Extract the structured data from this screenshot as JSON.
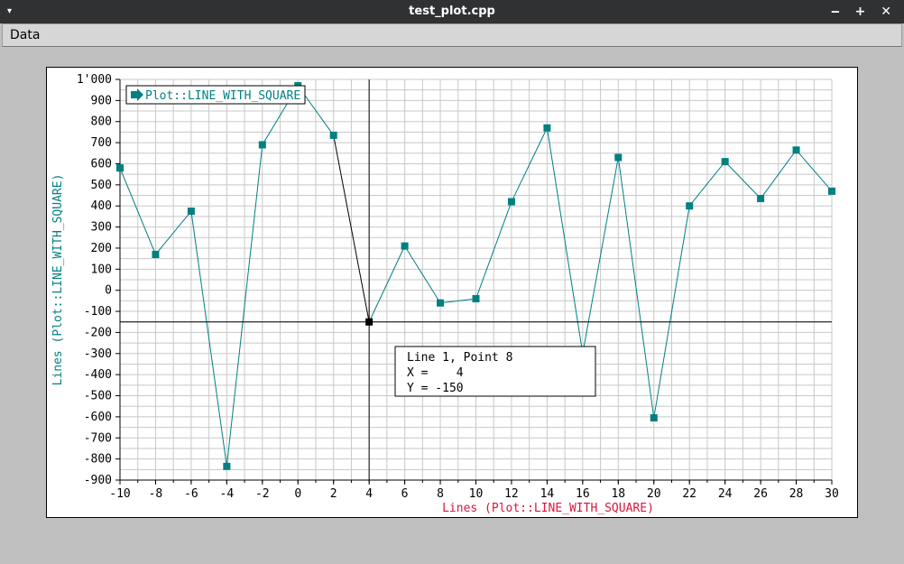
{
  "window": {
    "title": "test_plot.cpp",
    "menu_caret": "▾",
    "controls": "‒ + ✕"
  },
  "menu": {
    "items": [
      "Data"
    ]
  },
  "colors": {
    "series": "#008080",
    "xlabel": "#dc143c",
    "ylabel": "#008080",
    "grid": "#c8c8c8",
    "crosshair": "#000000"
  },
  "chart_data": {
    "type": "line",
    "title": "",
    "xlabel": "Lines (Plot::LINE_WITH_SQUARE)",
    "ylabel": "Lines (Plot::LINE_WITH_SQUARE)",
    "xlim": [
      -10,
      30
    ],
    "ylim": [
      -900,
      1000
    ],
    "grid": true,
    "legend_position": "top-left",
    "x_ticks": [
      -10,
      -8,
      -6,
      -4,
      -2,
      0,
      2,
      4,
      6,
      8,
      10,
      12,
      14,
      16,
      18,
      20,
      22,
      24,
      26,
      28,
      30
    ],
    "x_tick_labels": [
      "-10",
      "-8",
      "-6",
      "-4",
      "-2",
      "0",
      "2",
      "4",
      "6",
      "8",
      "10",
      "12",
      "14",
      "16",
      "18",
      "20",
      "22",
      "24",
      "26",
      "28",
      "30"
    ],
    "y_ticks": [
      -900,
      -800,
      -700,
      -600,
      -500,
      -400,
      -300,
      -200,
      -100,
      0,
      100,
      200,
      300,
      400,
      500,
      600,
      700,
      800,
      900,
      1000
    ],
    "y_tick_labels": [
      "-900",
      "-800",
      "-700",
      "-600",
      "-500",
      "-400",
      "-300",
      "-200",
      "-100",
      "0",
      "100",
      "200",
      "300",
      "400",
      "500",
      "600",
      "700",
      "800",
      "900",
      "1'000"
    ],
    "series": [
      {
        "name": "Plot::LINE_WITH_SQUARE",
        "x": [
          -10,
          -8,
          -6,
          -4,
          -2,
          0,
          2,
          4,
          6,
          8,
          10,
          12,
          14,
          16,
          18,
          20,
          22,
          24,
          26,
          28,
          30
        ],
        "values": [
          580,
          170,
          375,
          -835,
          690,
          970,
          735,
          -150,
          210,
          -60,
          -40,
          420,
          770,
          -300,
          630,
          -605,
          400,
          610,
          435,
          665,
          470
        ]
      }
    ],
    "selected_point": {
      "index": 7,
      "x": 4,
      "y": -150
    },
    "tooltip": {
      "line1": "Line 1, Point 8",
      "line2": "X =    4",
      "line3": "Y = -150"
    }
  }
}
